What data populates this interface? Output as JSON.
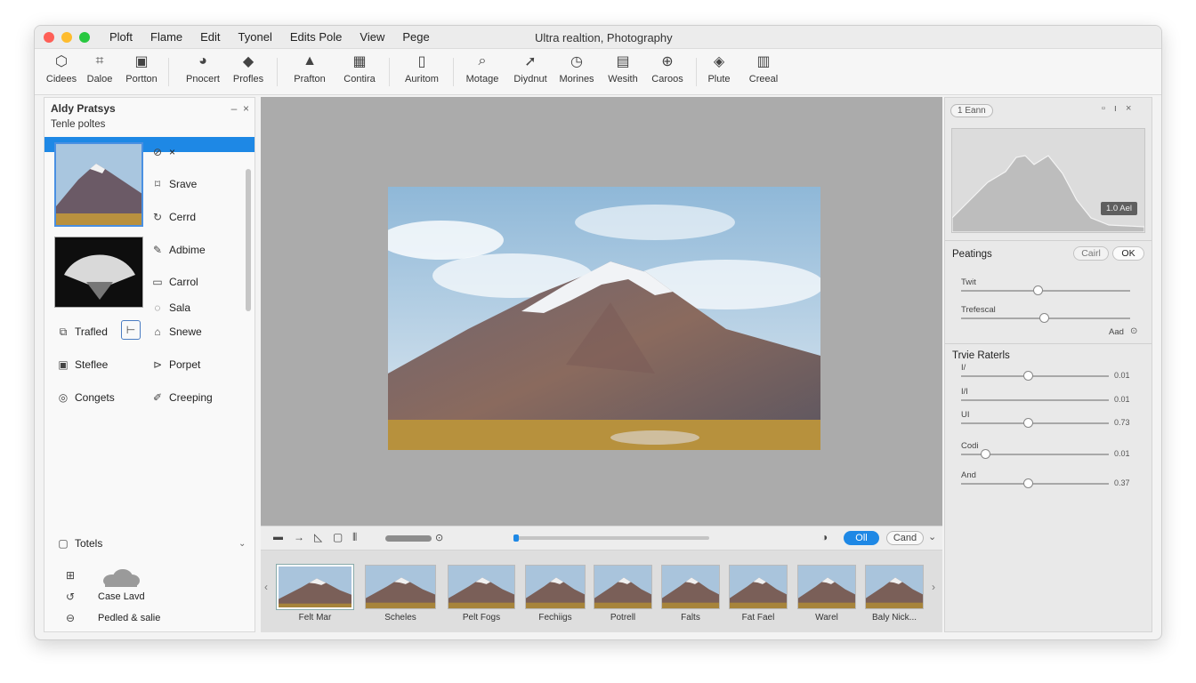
{
  "window_title": "Ultra realtion, Photography",
  "menu": [
    "Ploft",
    "Flame",
    "Edit",
    "Tyonel",
    "Edits Pole",
    "View",
    "Pege"
  ],
  "toolbar": [
    {
      "label": "Cidees",
      "icon": "hexagon-icon"
    },
    {
      "label": "Daloe",
      "icon": "chart-icon"
    },
    {
      "label": "Portton",
      "icon": "document-icon"
    },
    {
      "label": "Pnocert",
      "icon": "dial-icon"
    },
    {
      "label": "Profles",
      "icon": "layers-icon"
    },
    {
      "label": "Prafton",
      "icon": "shapes-icon"
    },
    {
      "label": "Contira",
      "icon": "grid-icon"
    },
    {
      "label": "Auritom",
      "icon": "file-icon"
    },
    {
      "label": "Motage",
      "icon": "search-icon"
    },
    {
      "label": "Diydnut",
      "icon": "cursor-icon"
    },
    {
      "label": "Morines",
      "icon": "clock-icon"
    },
    {
      "label": "Wesith",
      "icon": "folder-icon"
    },
    {
      "label": "Caroos",
      "icon": "globe-icon"
    },
    {
      "label": "Plute",
      "icon": "compass-icon"
    },
    {
      "label": "Creeal",
      "icon": "bar-icon"
    }
  ],
  "left_panel": {
    "title": "Aldy Pratsys",
    "subtitle": "Tenle poltes",
    "items": [
      {
        "label": "×",
        "icon": "circle-arrow-icon"
      },
      {
        "label": "Srave",
        "icon": "lock-icon"
      },
      {
        "label": "Cerrd",
        "icon": "refresh-icon"
      },
      {
        "label": "Adbime",
        "icon": "edit-icon"
      },
      {
        "label": "Carrol",
        "icon": "folder-icon"
      },
      {
        "label": "Sala",
        "icon": "chat-icon"
      }
    ],
    "grid": [
      {
        "label": "Trafled",
        "icon": "stack-icon"
      },
      {
        "label": "",
        "icon": "bracket-icon"
      },
      {
        "label": "Snewe",
        "icon": "user-icon"
      },
      {
        "label": "Steflee",
        "icon": "box-icon"
      },
      {
        "label": "Porpet",
        "icon": "tag-icon"
      },
      {
        "label": "Congets",
        "icon": "badge-icon"
      },
      {
        "label": "Creeping",
        "icon": "pencil-icon"
      }
    ],
    "footer_title": "Totels",
    "footer_items": [
      "Case Lavd",
      "Pedled & salie"
    ]
  },
  "controls": {
    "on_label": "Oll",
    "cancel_label": "Cand"
  },
  "filmstrip": [
    "Felt Mar",
    "Scheles",
    "Pelt Fogs",
    "Fechiigs",
    "Potrell",
    "Falts",
    "Fat Fael",
    "Warel",
    "Baly Nick..."
  ],
  "right_panel": {
    "tab_label": "1 Eann",
    "histogram_badge": "1.0 Ael",
    "section1_title": "Peatings",
    "cancel_label": "Cairl",
    "ok_label": "OK",
    "sliders1": [
      {
        "label": "Twit",
        "value": 0.45
      },
      {
        "label": "Trefescal",
        "value": 0.49
      }
    ],
    "auto_label": "Aad",
    "section2_title": "Trvie Raterls",
    "sliders2": [
      {
        "label": "I/",
        "value": 0.45,
        "display": "0.01"
      },
      {
        "label": "I/I",
        "value": null,
        "display": "0.01"
      },
      {
        "label": "UI",
        "value": 0.45,
        "display": "0.73"
      },
      {
        "label": "Codi",
        "value": 0.16,
        "display": "0.01"
      },
      {
        "label": "And",
        "value": 0.45,
        "display": "0.37"
      }
    ]
  }
}
